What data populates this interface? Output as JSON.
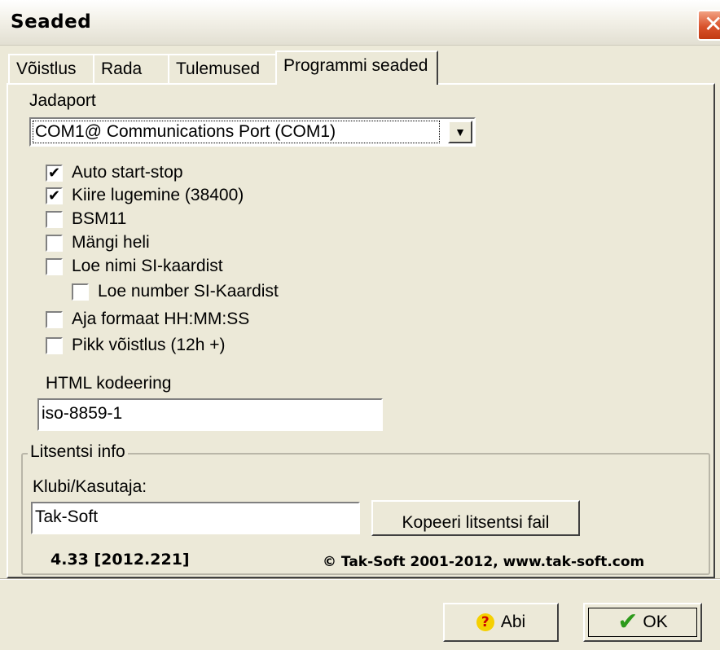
{
  "window": {
    "title": "Seaded",
    "close_glyph": "✕"
  },
  "tabs": [
    {
      "label": "Võistlus"
    },
    {
      "label": "Rada"
    },
    {
      "label": "Tulemused"
    },
    {
      "label": "Programmi seaded"
    }
  ],
  "serial": {
    "label": "Jadaport",
    "value": "COM1@ Communications Port (COM1)",
    "arrow_glyph": "▼"
  },
  "options": [
    {
      "label": "Auto start-stop",
      "checked": true
    },
    {
      "label": "Kiire lugemine (38400)",
      "checked": true
    },
    {
      "label": "BSM11",
      "checked": false
    },
    {
      "label": "Mängi heli",
      "checked": false
    },
    {
      "label": "Loe nimi SI-kaardist",
      "checked": false
    },
    {
      "label": "Loe number SI-Kaardist",
      "checked": false
    },
    {
      "label": "Aja formaat HH:MM:SS",
      "checked": false
    },
    {
      "label": "Pikk võistlus (12h +)",
      "checked": false
    }
  ],
  "html_encoding": {
    "label": "HTML kodeering",
    "value": "iso-8859-1"
  },
  "license": {
    "group_title": "Litsentsi info",
    "user_label": "Klubi/Kasutaja:",
    "user_value": "Tak-Soft",
    "copy_button": "Kopeeri litsentsi fail",
    "version": "4.33 [2012.221]",
    "copyright": "© Tak-Soft 2001-2012, www.tak-soft.com"
  },
  "buttons": {
    "help": "Abi",
    "help_glyph": "?",
    "ok": "OK",
    "ok_glyph": "✔"
  }
}
